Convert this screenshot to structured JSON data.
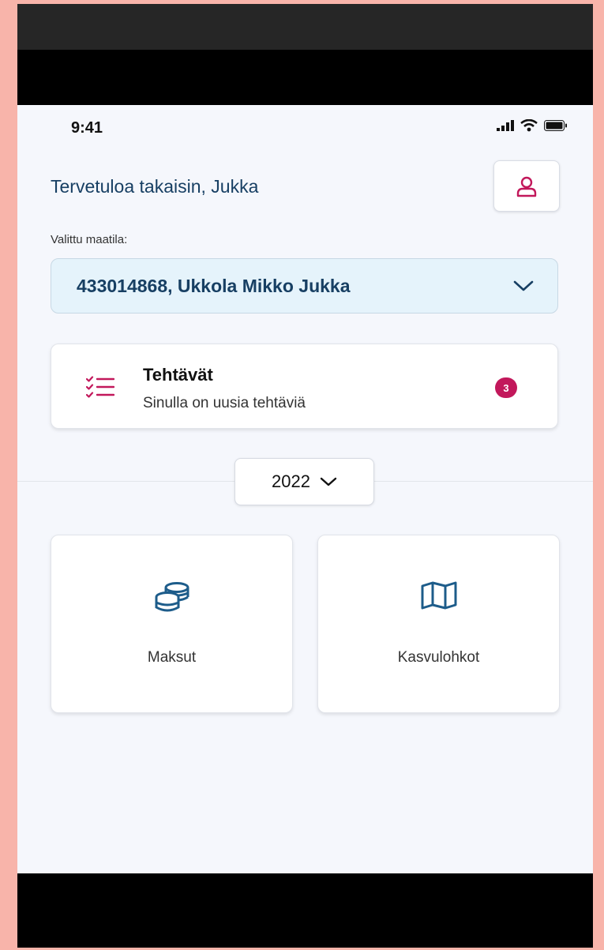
{
  "status_bar": {
    "time": "9:41"
  },
  "header": {
    "greeting": "Tervetuloa takaisin, Jukka"
  },
  "farm": {
    "label": "Valittu maatila:",
    "selected": "433014868, Ukkola Mikko Jukka"
  },
  "tasks": {
    "title": "Tehtävät",
    "subtitle": "Sinulla on uusia tehtäviä",
    "count": "3"
  },
  "year": {
    "selected": "2022"
  },
  "tiles": [
    {
      "label": "Maksut",
      "icon": "coins-icon"
    },
    {
      "label": "Kasvulohkot",
      "icon": "map-icon"
    }
  ],
  "colors": {
    "primary_text": "#173f63",
    "accent": "#c2185b",
    "icon_blue": "#1d5c8a",
    "select_bg": "#e5f3fb",
    "screen_bg": "#f5f7fc"
  }
}
